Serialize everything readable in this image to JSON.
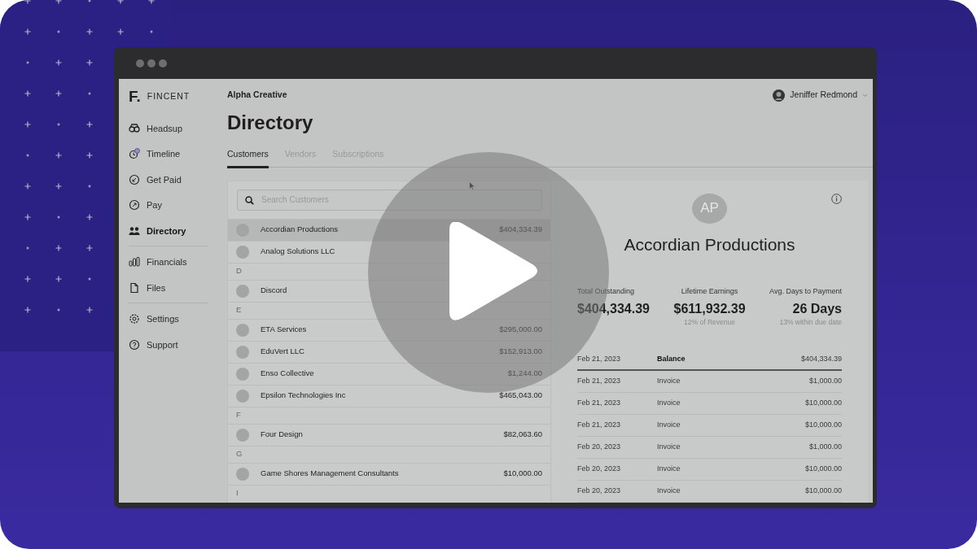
{
  "brand": {
    "logo": "F.",
    "name": "FINCENT"
  },
  "sidebar": {
    "groups": [
      [
        {
          "kind": "headsup",
          "label": "Headsup",
          "selected": false
        },
        {
          "kind": "timeline",
          "label": "Timeline",
          "selected": false
        },
        {
          "kind": "getpaid",
          "label": "Get Paid",
          "selected": false
        },
        {
          "kind": "pay",
          "label": "Pay",
          "selected": false
        },
        {
          "kind": "directory",
          "label": "Directory",
          "selected": true
        }
      ],
      [
        {
          "kind": "financials",
          "label": "Financials",
          "selected": false
        },
        {
          "kind": "files",
          "label": "Files",
          "selected": false
        }
      ],
      [
        {
          "kind": "settings",
          "label": "Settings",
          "selected": false
        },
        {
          "kind": "support",
          "label": "Support",
          "selected": false
        }
      ]
    ]
  },
  "header": {
    "company": "Alpha Creative",
    "user": "Jeniffer Redmond"
  },
  "page_title": "Directory",
  "tabs": [
    {
      "label": "Customers",
      "selected": true
    },
    {
      "label": "Vendors",
      "selected": false
    },
    {
      "label": "Subscriptions",
      "selected": false
    }
  ],
  "search": {
    "placeholder": "Search Customers"
  },
  "customers": [
    {
      "kind": "row",
      "name": "Accordian Productions",
      "amount": "$404,334.39",
      "selected": true
    },
    {
      "kind": "row",
      "name": "Analog Solutions LLC",
      "selected": false
    },
    {
      "kind": "letter",
      "label": "D"
    },
    {
      "kind": "row",
      "name": "Discord",
      "selected": false
    },
    {
      "kind": "letter",
      "label": "E"
    },
    {
      "kind": "row",
      "name": "ETA Services",
      "amount": "$295,000.00",
      "selected": false
    },
    {
      "kind": "row",
      "name": "EduVert LLC",
      "amount": "$152,913.00",
      "selected": false
    },
    {
      "kind": "row",
      "name": "Enso Collective",
      "amount": "$1,244.00",
      "selected": false
    },
    {
      "kind": "row",
      "name": "Epsilon Technologies Inc",
      "amount": "$465,043.00",
      "selected": false
    },
    {
      "kind": "letter",
      "label": "F"
    },
    {
      "kind": "row",
      "name": "Four Design",
      "amount": "$82,063.60",
      "selected": false
    },
    {
      "kind": "letter",
      "label": "G"
    },
    {
      "kind": "row",
      "name": "Game Shores Management Consultants",
      "amount": "$10,000.00",
      "selected": false
    },
    {
      "kind": "letter",
      "label": "I"
    }
  ],
  "detail": {
    "initials": "AP",
    "name": "Accordian Productions",
    "stats": [
      {
        "label": "Total Outstanding",
        "value": "$404,334.39"
      },
      {
        "label": "Lifetime Earnings",
        "value": "$611,932.39",
        "note": "12% of Revenue"
      },
      {
        "label": "Avg. Days to Payment",
        "value": "26 Days",
        "note": "13% within due date"
      }
    ],
    "ledger": [
      {
        "kind": "balance",
        "date": "Feb 21, 2023",
        "type": "Balance",
        "amount": "$404,334.39"
      },
      {
        "kind": "entry",
        "date": "Feb 21, 2023",
        "type": "Invoice",
        "amount": "$1,000.00"
      },
      {
        "kind": "entry",
        "date": "Feb 21, 2023",
        "type": "Invoice",
        "amount": "$10,000.00"
      },
      {
        "kind": "entry",
        "date": "Feb 21, 2023",
        "type": "Invoice",
        "amount": "$10,000.00"
      },
      {
        "kind": "entry",
        "date": "Feb 20, 2023",
        "type": "Invoice",
        "amount": "$1,000.00"
      },
      {
        "kind": "entry",
        "date": "Feb 20, 2023",
        "type": "Invoice",
        "amount": "$10,000.00"
      },
      {
        "kind": "entry",
        "date": "Feb 20, 2023",
        "type": "Invoice",
        "amount": "$10,000.00"
      }
    ]
  }
}
